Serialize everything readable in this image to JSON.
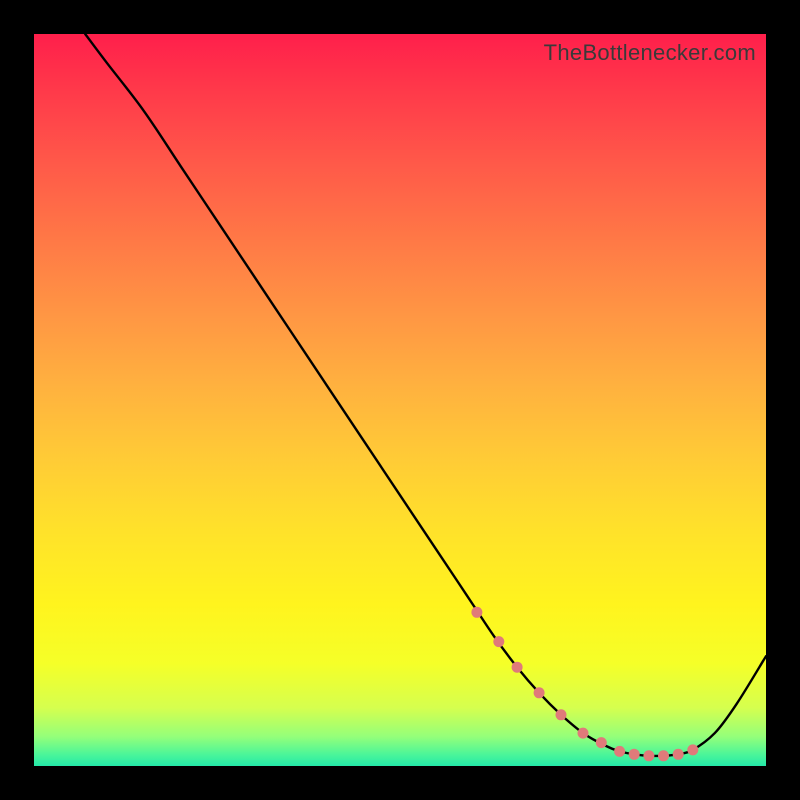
{
  "watermark": "TheBottlenecker.com",
  "chart_data": {
    "type": "line",
    "title": "",
    "xlabel": "",
    "ylabel": "",
    "xlim": [
      0,
      100
    ],
    "ylim": [
      0,
      100
    ],
    "series": [
      {
        "name": "bottleneck-curve",
        "x": [
          7,
          10,
          15,
          20,
          25,
          30,
          35,
          40,
          45,
          50,
          55,
          58,
          60,
          63,
          66,
          69,
          72,
          75,
          78,
          80,
          82,
          84,
          86,
          88,
          90,
          93,
          96,
          100
        ],
        "y": [
          100,
          96,
          89.5,
          82,
          74.5,
          67,
          59.5,
          52,
          44.5,
          37,
          29.5,
          25,
          22,
          17.5,
          13.5,
          10,
          7,
          4.5,
          2.8,
          2,
          1.6,
          1.4,
          1.4,
          1.6,
          2.2,
          4.5,
          8.5,
          15
        ]
      }
    ],
    "markers": {
      "name": "highlight-dots",
      "color": "#e07a7a",
      "x": [
        60.5,
        63.5,
        66,
        69,
        72,
        75,
        77.5,
        80,
        82,
        84,
        86,
        88,
        90
      ],
      "y": [
        21,
        17,
        13.5,
        10,
        7,
        4.5,
        3.2,
        2,
        1.6,
        1.4,
        1.4,
        1.6,
        2.2
      ]
    },
    "colors": {
      "curve": "#000000",
      "marker": "#e07a7a",
      "gradient_top": "#ff1f4b",
      "gradient_bottom": "#24e8a8"
    }
  }
}
